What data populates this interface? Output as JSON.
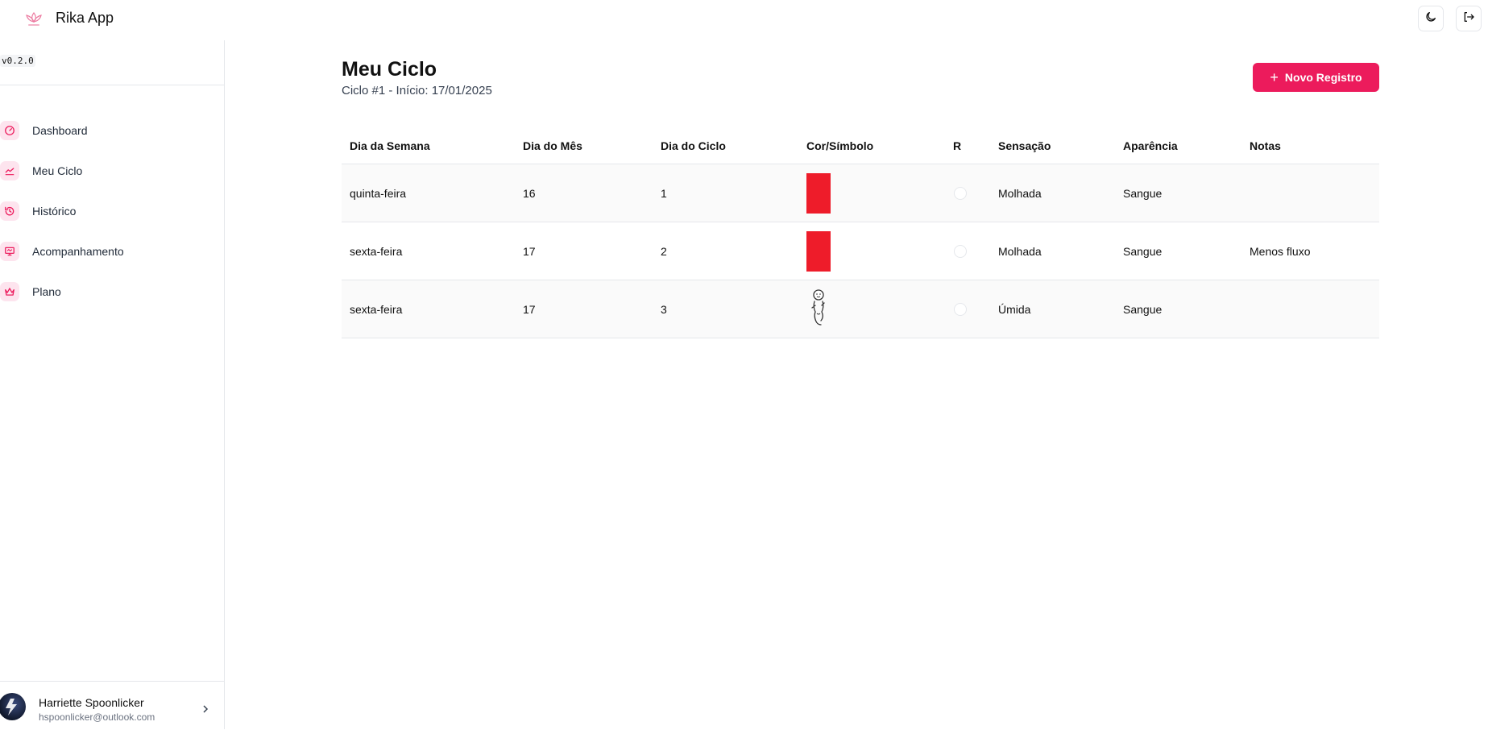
{
  "header": {
    "app_title": "Rika App",
    "logo_icon": "lotus-logo-icon"
  },
  "sidebar": {
    "version": "v0.2.0",
    "items": [
      {
        "label": "Dashboard",
        "icon": "gauge-icon"
      },
      {
        "label": "Meu Ciclo",
        "icon": "chart-line-icon"
      },
      {
        "label": "Histórico",
        "icon": "history-icon"
      },
      {
        "label": "Acompanhamento",
        "icon": "monitor-icon"
      },
      {
        "label": "Plano",
        "icon": "crown-icon"
      }
    ],
    "user": {
      "name": "Harriette Spoonlicker",
      "email": "hspoonlicker@outlook.com"
    }
  },
  "main": {
    "title": "Meu Ciclo",
    "subtitle": "Ciclo #1 - Início: 17/01/2025",
    "new_button": "Novo Registro",
    "accent": "#ec1b5c",
    "table": {
      "headers": [
        "Dia da Semana",
        "Dia do Mês",
        "Dia do Ciclo",
        "Cor/Símbolo",
        "R",
        "Sensação",
        "Aparência",
        "Notas"
      ],
      "rows": [
        {
          "weekday": "quinta-feira",
          "month_day": "16",
          "cycle_day": "1",
          "symbol": "red",
          "sensation": "Molhada",
          "appearance": "Sangue",
          "notes": ""
        },
        {
          "weekday": "sexta-feira",
          "month_day": "17",
          "cycle_day": "2",
          "symbol": "red",
          "sensation": "Molhada",
          "appearance": "Sangue",
          "notes": "Menos fluxo"
        },
        {
          "weekday": "sexta-feira",
          "month_day": "17",
          "cycle_day": "3",
          "symbol": "baby",
          "sensation": "Úmida",
          "appearance": "Sangue",
          "notes": ""
        }
      ]
    }
  },
  "colors": {
    "symbol_red": "#ee1c2a",
    "accent_pink": "#ec1b5c"
  }
}
